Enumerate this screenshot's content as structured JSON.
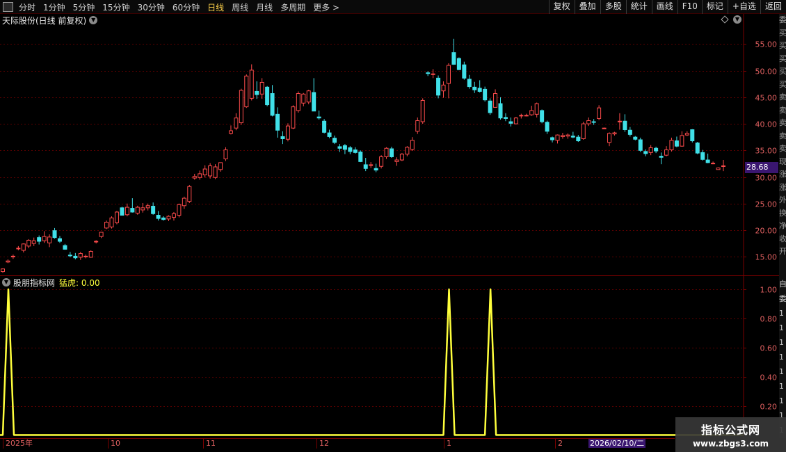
{
  "toolbar": {
    "periods": [
      {
        "label": "分时",
        "active": false
      },
      {
        "label": "1分钟",
        "active": false
      },
      {
        "label": "5分钟",
        "active": false
      },
      {
        "label": "15分钟",
        "active": false
      },
      {
        "label": "30分钟",
        "active": false
      },
      {
        "label": "60分钟",
        "active": false
      },
      {
        "label": "日线",
        "active": true
      },
      {
        "label": "周线",
        "active": false
      },
      {
        "label": "月线",
        "active": false
      },
      {
        "label": "多周期",
        "active": false
      },
      {
        "label": "更多 >",
        "active": false
      }
    ],
    "right_buttons": [
      "复权",
      "叠加",
      "多股",
      "统计",
      "画线",
      "F10",
      "标记",
      "+自选",
      "返回"
    ]
  },
  "stock": {
    "title": "天际股份(日线 前复权)"
  },
  "current_price_label": "28.68",
  "indicator": {
    "name": "股朋指标网",
    "series_label": "猛虎: 0.00"
  },
  "side_strip": {
    "upper": [
      "委",
      "买",
      "买",
      "买",
      "买",
      "买",
      "卖",
      "卖",
      "卖",
      "卖",
      "卖",
      "现",
      "涨",
      "涨",
      "外",
      "换",
      "净",
      "收",
      "开"
    ],
    "lower": [
      "自",
      "委",
      "1",
      "1",
      "1",
      "1",
      "1",
      "1",
      "1",
      "1",
      "1",
      "1"
    ]
  },
  "colors": {
    "up": "#ff4c4c",
    "down": "#40e0e8",
    "indicator": "#ffff3c",
    "axis": "#7a0000",
    "grid": "#5a0000",
    "axis_text": "#e06060"
  },
  "date_axis": {
    "labels": [
      "2025年",
      "10",
      "11",
      "12",
      "1",
      "2"
    ],
    "cursor_date": "2026/02/10/二"
  },
  "watermark": {
    "title": "指标公式网",
    "url": "www.zbgs3.com"
  },
  "chart_data": [
    {
      "type": "candlestick",
      "title": "天际股份(日线 前复权)",
      "ylim": [
        10,
        57
      ],
      "y_ticks": [
        15,
        20,
        25,
        30,
        35,
        40,
        45,
        50,
        55
      ],
      "y_tick_labels": [
        "15.00",
        "20.00",
        "25.00",
        "30.00",
        "35.00",
        "40.00",
        "45.00",
        "50.00",
        "55.00"
      ],
      "ohlc": [
        [
          12.2,
          12.8,
          12.0,
          12.7
        ],
        [
          14.0,
          14.5,
          13.8,
          14.2
        ],
        [
          15.0,
          15.4,
          14.6,
          15.1
        ],
        [
          16.5,
          17.0,
          16.2,
          16.6
        ],
        [
          16.2,
          17.5,
          15.8,
          17.4
        ],
        [
          17.0,
          18.3,
          16.6,
          18.1
        ],
        [
          17.5,
          18.6,
          17.0,
          18.0
        ],
        [
          18.6,
          19.0,
          17.3,
          17.9
        ],
        [
          18.0,
          19.8,
          17.6,
          18.8
        ],
        [
          17.6,
          19.2,
          16.8,
          18.7
        ],
        [
          19.9,
          20.4,
          18.4,
          18.6
        ],
        [
          18.4,
          18.9,
          17.6,
          17.9
        ],
        [
          17.1,
          17.4,
          16.3,
          16.4
        ],
        [
          15.3,
          15.9,
          14.9,
          15.2
        ],
        [
          15.1,
          15.7,
          14.5,
          14.8
        ],
        [
          14.9,
          15.9,
          14.4,
          15.6
        ],
        [
          15.0,
          15.4,
          14.7,
          15.1
        ],
        [
          14.9,
          16.2,
          14.8,
          16.0
        ],
        [
          17.8,
          18.1,
          17.5,
          17.9
        ],
        [
          18.8,
          19.6,
          18.5,
          19.6
        ],
        [
          20.4,
          21.8,
          20.2,
          21.5
        ],
        [
          20.6,
          22.6,
          20.3,
          22.3
        ],
        [
          21.4,
          23.6,
          21.1,
          23.4
        ],
        [
          24.2,
          24.4,
          22.8,
          22.8
        ],
        [
          22.9,
          25.0,
          22.6,
          24.3
        ],
        [
          24.1,
          26.0,
          23.3,
          23.4
        ],
        [
          23.2,
          24.6,
          22.9,
          24.3
        ],
        [
          23.8,
          25.1,
          23.3,
          24.2
        ],
        [
          24.2,
          25.0,
          23.7,
          24.6
        ],
        [
          24.5,
          25.2,
          22.9,
          23.1
        ],
        [
          22.8,
          23.6,
          21.8,
          22.2
        ],
        [
          22.3,
          22.6,
          21.8,
          22.0
        ],
        [
          22.1,
          22.8,
          21.7,
          22.6
        ],
        [
          22.4,
          23.4,
          21.8,
          23.1
        ],
        [
          22.8,
          25.0,
          22.4,
          24.8
        ],
        [
          24.6,
          26.3,
          24.0,
          26.0
        ],
        [
          25.4,
          28.5,
          25.1,
          28.2
        ],
        [
          29.8,
          30.6,
          29.5,
          30.1
        ],
        [
          29.9,
          31.2,
          29.5,
          30.6
        ],
        [
          30.4,
          32.2,
          29.9,
          31.5
        ],
        [
          30.2,
          32.6,
          29.7,
          32.1
        ],
        [
          29.9,
          32.4,
          29.6,
          31.9
        ],
        [
          31.4,
          32.7,
          31.0,
          32.7
        ],
        [
          33.4,
          35.6,
          33.0,
          35.1
        ],
        [
          38.2,
          39.7,
          38.0,
          38.7
        ],
        [
          39.2,
          42.0,
          38.8,
          41.1
        ],
        [
          40.2,
          46.6,
          39.8,
          46.3
        ],
        [
          43.2,
          49.3,
          43.0,
          49.0
        ],
        [
          44.8,
          51.2,
          44.4,
          50.1
        ],
        [
          46.1,
          48.0,
          44.7,
          45.5
        ],
        [
          45.6,
          48.6,
          44.7,
          47.8
        ],
        [
          46.9,
          47.1,
          43.3,
          43.6
        ],
        [
          45.7,
          47.3,
          41.4,
          41.6
        ],
        [
          41.8,
          43.1,
          37.4,
          38.8
        ],
        [
          37.6,
          38.6,
          36.2,
          37.2
        ],
        [
          37.1,
          40.1,
          36.7,
          39.6
        ],
        [
          39.2,
          43.5,
          39.0,
          43.2
        ],
        [
          42.5,
          46.1,
          42.1,
          45.7
        ],
        [
          43.9,
          45.8,
          43.3,
          45.6
        ],
        [
          44.1,
          46.4,
          43.7,
          46.2
        ],
        [
          45.9,
          48.6,
          42.4,
          42.4
        ],
        [
          41.3,
          42.5,
          40.8,
          41.1
        ],
        [
          40.5,
          40.9,
          38.2,
          38.4
        ],
        [
          38.3,
          38.9,
          37.3,
          37.6
        ],
        [
          37.3,
          37.8,
          36.2,
          36.5
        ],
        [
          35.7,
          36.2,
          34.7,
          35.4
        ],
        [
          35.9,
          36.2,
          34.3,
          35.2
        ],
        [
          35.5,
          35.8,
          34.3,
          34.8
        ],
        [
          35.1,
          35.6,
          34.4,
          34.6
        ],
        [
          34.7,
          35.0,
          32.8,
          32.9
        ],
        [
          32.3,
          33.6,
          31.1,
          31.6
        ],
        [
          32.3,
          32.8,
          31.7,
          32.3
        ],
        [
          31.6,
          32.5,
          30.9,
          31.3
        ],
        [
          32.0,
          34.1,
          31.6,
          33.8
        ],
        [
          33.8,
          35.6,
          33.4,
          35.4
        ],
        [
          35.3,
          35.7,
          33.6,
          33.8
        ],
        [
          32.9,
          33.7,
          32.1,
          33.2
        ],
        [
          33.2,
          34.5,
          33.0,
          34.3
        ],
        [
          34.3,
          35.8,
          33.9,
          35.6
        ],
        [
          35.2,
          37.5,
          34.9,
          36.9
        ],
        [
          38.6,
          41.2,
          38.1,
          40.6
        ],
        [
          40.4,
          44.8,
          40.0,
          44.4
        ],
        [
          49.6,
          49.9,
          49.0,
          49.5
        ],
        [
          49.4,
          50.3,
          48.6,
          49.4
        ],
        [
          48.6,
          49.1,
          44.8,
          45.4
        ],
        [
          46.2,
          48.0,
          44.9,
          47.3
        ],
        [
          47.6,
          51.4,
          44.8,
          51.0
        ],
        [
          53.4,
          56.0,
          51.1,
          51.2
        ],
        [
          52.3,
          52.5,
          50.1,
          50.2
        ],
        [
          51.1,
          51.7,
          48.3,
          48.6
        ],
        [
          48.4,
          49.2,
          46.6,
          47.0
        ],
        [
          46.9,
          47.9,
          45.8,
          46.4
        ],
        [
          46.7,
          48.2,
          45.9,
          46.1
        ],
        [
          46.5,
          47.0,
          44.2,
          44.5
        ],
        [
          44.3,
          44.8,
          41.7,
          42.1
        ],
        [
          43.1,
          46.5,
          43.1,
          45.7
        ],
        [
          43.8,
          45.0,
          40.8,
          41.1
        ],
        [
          41.2,
          42.0,
          40.5,
          41.0
        ],
        [
          40.4,
          41.2,
          39.5,
          40.1
        ],
        [
          40.0,
          41.3,
          39.9,
          41.1
        ],
        [
          41.5,
          41.9,
          41.0,
          41.6
        ],
        [
          41.5,
          41.9,
          41.4,
          41.6
        ],
        [
          41.7,
          43.4,
          41.5,
          42.5
        ],
        [
          41.8,
          44.0,
          41.2,
          43.8
        ],
        [
          42.5,
          42.7,
          40.1,
          40.4
        ],
        [
          40.3,
          40.6,
          38.1,
          38.6
        ],
        [
          37.4,
          37.6,
          36.5,
          37.0
        ],
        [
          36.9,
          38.0,
          36.3,
          37.9
        ],
        [
          37.6,
          38.3,
          37.2,
          37.8
        ],
        [
          37.7,
          38.2,
          37.2,
          37.9
        ],
        [
          37.7,
          38.5,
          37.3,
          37.5
        ],
        [
          37.5,
          37.9,
          36.6,
          36.8
        ],
        [
          37.2,
          40.4,
          37.0,
          40.0
        ],
        [
          40.0,
          41.2,
          39.6,
          40.6
        ],
        [
          40.4,
          40.9,
          39.8,
          40.3
        ],
        [
          41.0,
          43.5,
          40.7,
          43.0
        ],
        [
          39.2,
          39.3,
          39.1,
          39.2
        ],
        [
          36.5,
          38.4,
          35.8,
          38.2
        ],
        [
          38.1,
          38.5,
          37.8,
          38.3
        ],
        [
          40.5,
          42.0,
          38.9,
          40.5
        ],
        [
          40.5,
          41.8,
          38.5,
          38.9
        ],
        [
          38.8,
          39.4,
          37.6,
          38.0
        ],
        [
          37.5,
          37.7,
          36.9,
          37.1
        ],
        [
          37.0,
          37.4,
          34.7,
          35.0
        ],
        [
          34.8,
          35.2,
          33.9,
          34.4
        ],
        [
          34.6,
          36.0,
          34.1,
          35.5
        ],
        [
          35.4,
          35.7,
          34.5,
          34.9
        ],
        [
          33.9,
          34.6,
          32.4,
          33.7
        ],
        [
          34.1,
          35.8,
          33.9,
          35.1
        ],
        [
          35.1,
          37.4,
          34.8,
          36.9
        ],
        [
          36.8,
          37.6,
          35.6,
          35.8
        ],
        [
          35.8,
          38.6,
          35.7,
          37.8
        ],
        [
          37.9,
          38.6,
          37.7,
          38.2
        ],
        [
          38.9,
          39.0,
          36.5,
          36.8
        ],
        [
          36.4,
          36.6,
          34.3,
          34.5
        ],
        [
          34.6,
          35.1,
          33.1,
          33.3
        ],
        [
          33.2,
          34.4,
          32.6,
          32.7
        ],
        [
          32.6,
          32.9,
          32.4,
          32.6
        ],
        [
          31.4,
          31.8,
          31.4,
          31.7
        ],
        [
          32.1,
          33.2,
          31.1,
          32.1
        ]
      ]
    },
    {
      "type": "line",
      "title": "股朋指标网",
      "series": [
        {
          "name": "猛虎",
          "values": [
            1,
            0,
            0,
            0,
            0,
            0,
            0,
            0,
            0,
            0,
            0,
            0,
            0,
            0,
            0,
            0,
            0,
            0,
            0,
            0,
            0,
            0,
            0,
            0,
            0,
            0,
            0,
            0,
            0,
            0,
            0,
            0,
            0,
            0,
            0,
            0,
            0,
            0,
            0,
            0,
            0,
            0,
            0,
            0,
            0,
            0,
            0,
            0,
            0,
            0,
            0,
            0,
            0,
            0,
            0,
            0,
            0,
            0,
            0,
            0,
            0,
            0,
            0,
            0,
            0,
            0,
            0,
            0,
            0,
            0,
            0,
            0,
            0,
            0,
            0,
            0,
            0,
            0,
            0,
            0,
            0,
            0,
            0,
            0,
            0,
            1,
            0,
            0,
            0,
            0,
            0,
            0,
            0,
            0,
            0,
            0,
            0,
            0,
            0,
            0,
            0,
            0,
            0,
            0,
            0,
            0,
            0,
            0,
            0,
            0,
            0,
            0,
            0,
            0,
            0,
            0,
            0,
            0,
            0,
            0,
            0,
            0,
            0,
            0,
            0,
            0,
            0,
            0,
            0,
            0,
            0,
            0,
            0,
            0,
            0,
            0,
            0,
            0,
            0,
            0,
            0,
            0,
            0,
            0,
            0,
            0
          ]
        }
      ],
      "spike_indices": [
        0,
        85,
        93
      ],
      "ylim": [
        0,
        1.08
      ],
      "y_ticks": [
        0.2,
        0.4,
        0.6,
        0.8,
        1.0
      ],
      "y_tick_labels": [
        "0.20",
        "0.40",
        "0.60",
        "0.80",
        "1.00"
      ],
      "last_value": 0.0
    }
  ]
}
